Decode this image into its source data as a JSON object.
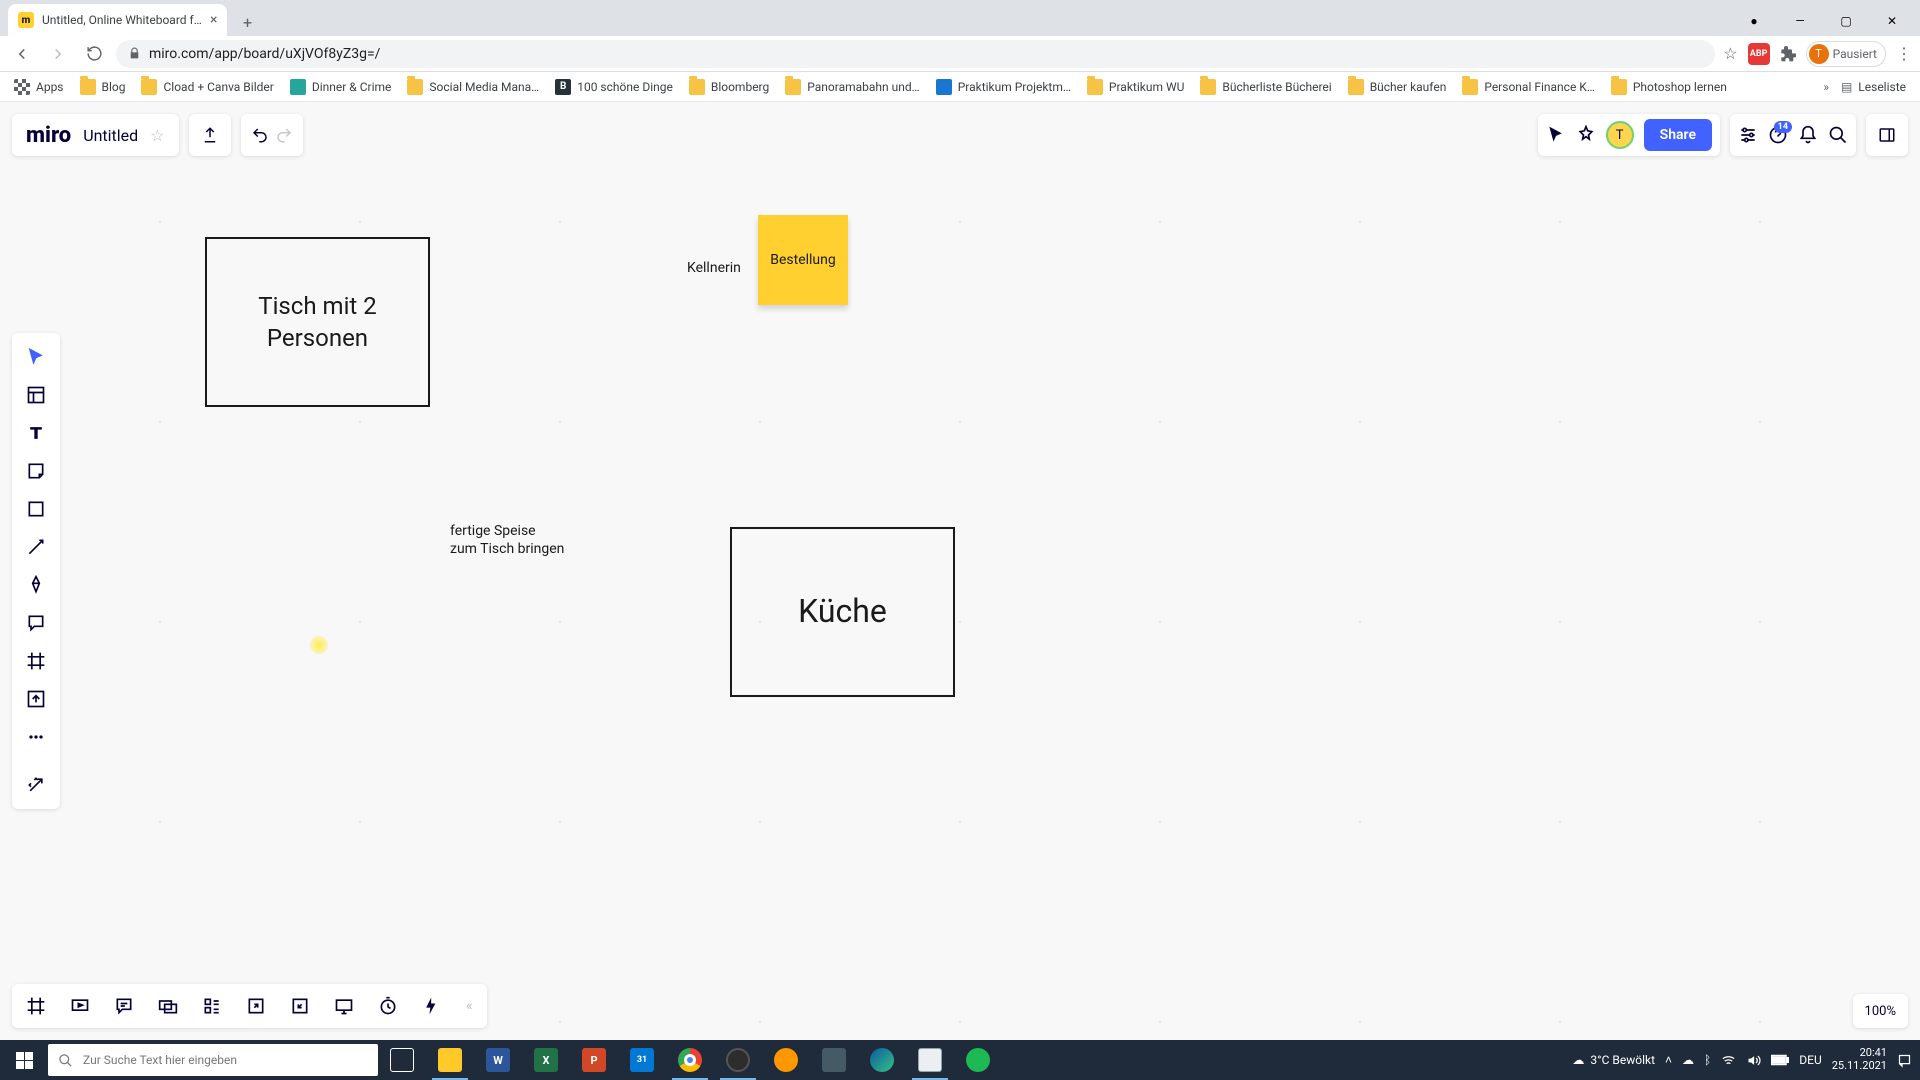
{
  "browser": {
    "tab_title": "Untitled, Online Whiteboard for",
    "url": "miro.com/app/board/uXjVOf8yZ3g=/",
    "avatar_label": "Pausiert",
    "bookmarks": [
      {
        "label": "Apps",
        "icon": "apps"
      },
      {
        "label": "Blog",
        "icon": "folder"
      },
      {
        "label": "Cload + Canva Bilder",
        "icon": "folder"
      },
      {
        "label": "Dinner & Crime",
        "icon": "teal"
      },
      {
        "label": "Social Media Mana…",
        "icon": "folder"
      },
      {
        "label": "100 schöne Dinge",
        "icon": "dark"
      },
      {
        "label": "Bloomberg",
        "icon": "folder"
      },
      {
        "label": "Panoramabahn und…",
        "icon": "folder"
      },
      {
        "label": "Praktikum Projektm…",
        "icon": "blue"
      },
      {
        "label": "Praktikum WU",
        "icon": "folder"
      },
      {
        "label": "Bücherliste Bücherei",
        "icon": "folder"
      },
      {
        "label": "Bücher kaufen",
        "icon": "folder"
      },
      {
        "label": "Personal Finance K…",
        "icon": "folder"
      },
      {
        "label": "Photoshop lernen",
        "icon": "folder"
      }
    ],
    "reading_list": "Leseliste"
  },
  "miro": {
    "logo": "miro",
    "board_title": "Untitled",
    "share": "Share",
    "help_badge": "14",
    "avatar_initial": "T",
    "zoom": "100%"
  },
  "board": {
    "rect1": "Tisch mit 2\nPersonen",
    "rect2": "Küche",
    "sticky": "Bestellung",
    "label_kellnerin": "Kellnerin",
    "label_speise": "fertige Speise\nzum Tisch bringen"
  },
  "taskbar": {
    "search_placeholder": "Zur Suche Text hier eingeben",
    "weather": "3°C  Bewölkt",
    "lang": "DEU",
    "time": "20:41",
    "date": "25.11.2021"
  }
}
